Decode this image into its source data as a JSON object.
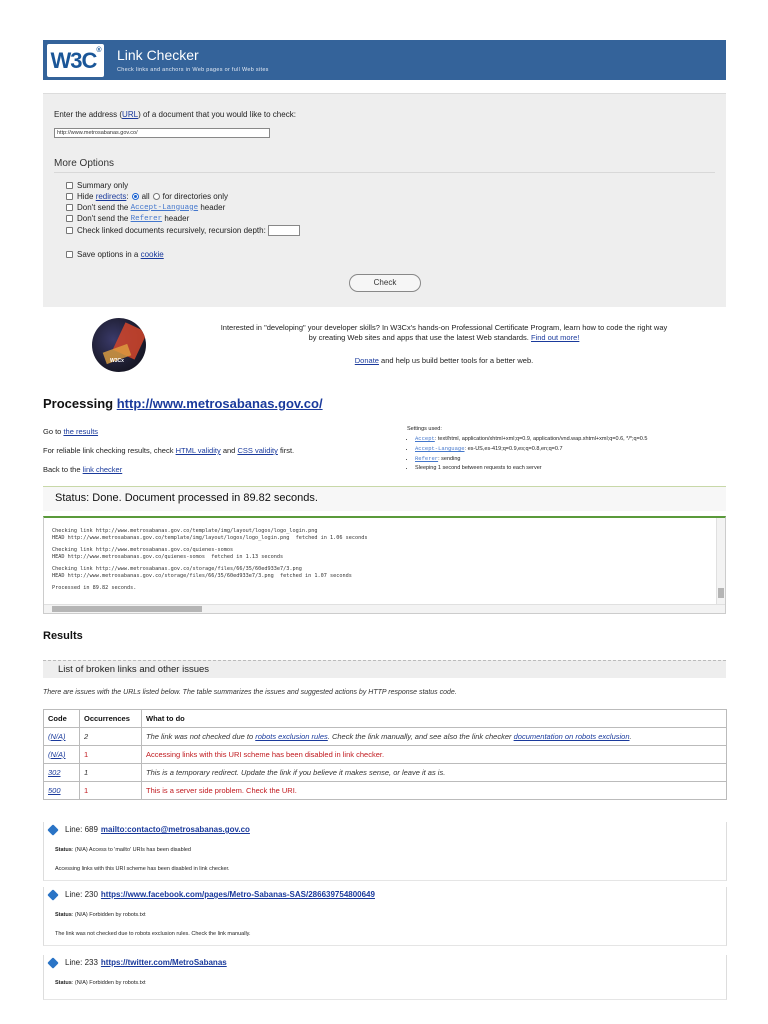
{
  "banner": {
    "logo": "W3C",
    "title": "Link Checker",
    "subtitle": "Check links and anchors in Web pages or full Web sites"
  },
  "form": {
    "enter_prefix": "Enter the address (",
    "enter_link": "URL",
    "enter_suffix": ") of a document that you would like to check:",
    "url_value": "http://www.metrosabanas.gov.co/",
    "more_options": "More Options",
    "opt_summary": "Summary only",
    "opt_hide_prefix": "Hide",
    "opt_hide_link": "redirects",
    "opt_hide_colon": ":",
    "opt_all": "all",
    "opt_dirs": "for directories only",
    "opt_accept_prefix": "Don't send the",
    "opt_accept_code": "Accept-Language",
    "opt_header": "header",
    "opt_referer_prefix": "Don't send the",
    "opt_referer_code": "Referer",
    "opt_recursive": "Check linked documents recursively, recursion depth:",
    "opt_save_prefix": "Save options in a",
    "opt_save_link": "cookie",
    "check_button": "Check"
  },
  "promo": {
    "logo_label": "W3Cx",
    "text_1": "Interested in \"developing\" your developer skills? In W3Cx's hands-on Professional Certificate Program, learn how to code the right way",
    "text_2": "by creating Web sites and apps that use the latest Web standards.",
    "find_out": "Find out more!",
    "donate": "Donate",
    "donate_suffix": "and help us build better tools for a better web."
  },
  "processing": {
    "prefix": "Processing",
    "url": "http://www.metrosabanas.gov.co/",
    "goto_prefix": "Go to",
    "goto_link": "the results",
    "reliable_prefix": "For reliable link checking results, check",
    "html_validity": "HTML validity",
    "and": "and",
    "css_validity": "CSS validity",
    "first": "first.",
    "back_prefix": "Back to the",
    "back_link": "link checker"
  },
  "settings": {
    "title": "Settings used:",
    "accept_code": "Accept",
    "accept_value": ": text/html, application/xhtml+xml;q=0.9, application/vnd.wap.xhtml+xml;q=0.6, */*;q=0.5",
    "lang_code": "Accept-Language",
    "lang_value": ": es-US,es-419;q=0.9,es;q=0.8,en;q=0.7",
    "referer_code": "Referer",
    "referer_value": ": sending",
    "sleeping": "Sleeping 1 second between requests to each server"
  },
  "status": "Status: Done. Document processed in 89.82 seconds.",
  "log": {
    "b1_l1": "Checking link http://www.metrosabanas.gov.co/template/img/layout/logos/logo_login.png",
    "b1_l2": "HEAD http://www.metrosabanas.gov.co/template/img/layout/logos/logo_login.png  fetched in 1.06 seconds",
    "b2_l1": "Checking link http://www.metrosabanas.gov.co/quienes-somos",
    "b2_l2": "HEAD http://www.metrosabanas.gov.co/quienes-somos  fetched in 1.13 seconds",
    "b3_l1": "Checking link http://www.metrosabanas.gov.co/storage/files/66/35/60ed933e7/3.png",
    "b3_l2": "HEAD http://www.metrosabanas.gov.co/storage/files/66/35/60ed933e7/3.png  fetched in 1.07 seconds",
    "done": "Processed in 89.82 seconds."
  },
  "results": {
    "heading": "Results",
    "list_heading": "List of broken links and other issues",
    "note": "There are issues with the URLs listed below. The table summarizes the issues and suggested actions by HTTP response status code.",
    "col_code": "Code",
    "col_occ": "Occurrences",
    "col_what": "What to do",
    "r1_code": "(N/A)",
    "r1_occ": "2",
    "r1_what_a": "The link was not checked due to",
    "r1_link1": "robots exclusion rules",
    "r1_what_b": ". Check the link manually, and see also the link checker",
    "r1_link2": "documentation on robots exclusion",
    "r1_what_c": ".",
    "r2_code": "(N/A)",
    "r2_occ": "1",
    "r2_what": "Accessing links with this URI scheme has been disabled in link checker.",
    "r3_code": "302",
    "r3_occ": "1",
    "r3_what": "This is a temporary redirect. Update the link if you believe it makes sense, or leave it as is.",
    "r4_code": "500",
    "r4_occ": "1",
    "r4_what": "This is a server side problem. Check the URI."
  },
  "entries": {
    "e1_line": "Line: 689",
    "e1_url": "mailto:contacto@metrosabanas.gov.co",
    "e1_status_label": "Status",
    "e1_status": ": (N/A) Access to 'mailto' URIs has been disabled",
    "e1_desc": "Accessing links with this URI scheme has been disabled in link checker.",
    "e2_line": "Line: 230",
    "e2_url": "https://www.facebook.com/pages/Metro-Sabanas-SAS/286639754800649",
    "e2_status_label": "Status",
    "e2_status": ": (N/A) Forbidden by robots.txt",
    "e2_desc": "The link was not checked due to robots exclusion rules. Check the link manually.",
    "e3_line": "Line: 233",
    "e3_url": "https://twitter.com/MetroSabanas",
    "e3_status_label": "Status",
    "e3_status": ": (N/A) Forbidden by robots.txt"
  },
  "colors": {
    "banner": "#34639a",
    "link": "#1a3a9c",
    "error_red": "#c0181d",
    "log_border": "#5a9a3a"
  }
}
